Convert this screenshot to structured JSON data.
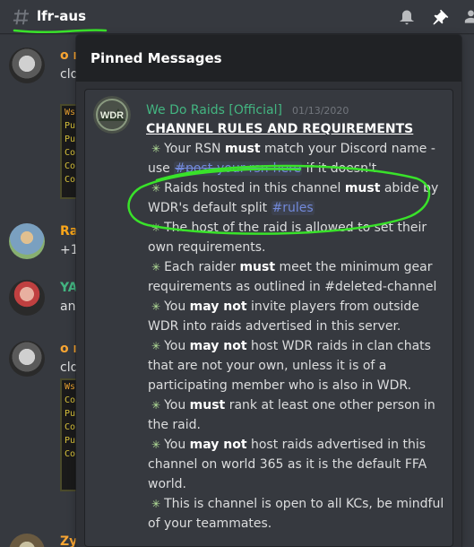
{
  "header": {
    "channel_name": "lfr-aus"
  },
  "chat": {
    "messages": [
      {
        "author": "o r",
        "text": "clo",
        "author_color": "#f8a532",
        "embed_lines": [
          "Ws",
          "Pu",
          "Pu",
          "Co",
          "Co",
          "Co"
        ]
      },
      {
        "author": "Ra",
        "text": "+1",
        "author_color": "#faa61a"
      },
      {
        "author": "YA",
        "text": "any",
        "author_color": "#43b581"
      },
      {
        "author": "o r",
        "text": "clo",
        "author_color": "#f8a532",
        "embed_lines": [
          "Ws",
          "Co",
          "Pu",
          "Co",
          "Pu",
          "Co"
        ]
      },
      {
        "author": "Zy",
        "text": "",
        "author_color": "#f8a532"
      }
    ]
  },
  "popout": {
    "title": "Pinned Messages",
    "message": {
      "avatar_text": "WDR",
      "author": "We Do Raids [Official]",
      "date": "01/13/2020",
      "heading": "CHANNEL RULES AND REQUIREMENTS",
      "rules": [
        {
          "pre": "Your RSN ",
          "bold": "must",
          "post": " match your Discord name - use ",
          "mention": "#post-your-rsn-here",
          "tail": " if it doesn't."
        },
        {
          "pre": "Raids hosted in this channel ",
          "bold": "must",
          "post": " abide by WDR's default split ",
          "mention": "#rules",
          "tail": ""
        },
        {
          "pre": "The host of the raid is allowed to set their own requirements.",
          "bold": "",
          "post": "",
          "mention": "",
          "tail": ""
        },
        {
          "pre": "Each raider ",
          "bold": "must",
          "post": " meet the minimum gear requirements as outlined in #deleted-channel",
          "mention": "",
          "tail": ""
        },
        {
          "pre": "You ",
          "bold": "may not",
          "post": " invite players from outside WDR into raids advertised in this server.",
          "mention": "",
          "tail": ""
        },
        {
          "pre": "You ",
          "bold": "may not",
          "post": " host WDR raids in clan chats that are not your own, unless it is of a participating member who is also in WDR.",
          "mention": "",
          "tail": ""
        },
        {
          "pre": "You ",
          "bold": "must",
          "post": " rank at least one other person in the raid.",
          "mention": "",
          "tail": ""
        },
        {
          "pre": "You ",
          "bold": "may not",
          "post": " host raids advertised in this channel on world 365 as it is the default FFA world.",
          "mention": "",
          "tail": ""
        },
        {
          "pre": "This is channel is open to all KCs, be mindful of your teammates.",
          "bold": "",
          "post": "",
          "mention": "",
          "tail": ""
        }
      ],
      "sparkle": "✳"
    }
  },
  "colors": {
    "background": "#36393f",
    "popout_bg": "#2f3136",
    "popout_header": "#202225",
    "author_green": "#43b581",
    "mention": "#7289da",
    "annotation": "#39e22a"
  },
  "icons": {
    "hash": "hashtag-icon",
    "bell": "bell-icon",
    "pin": "pin-icon",
    "members": "members-icon"
  }
}
